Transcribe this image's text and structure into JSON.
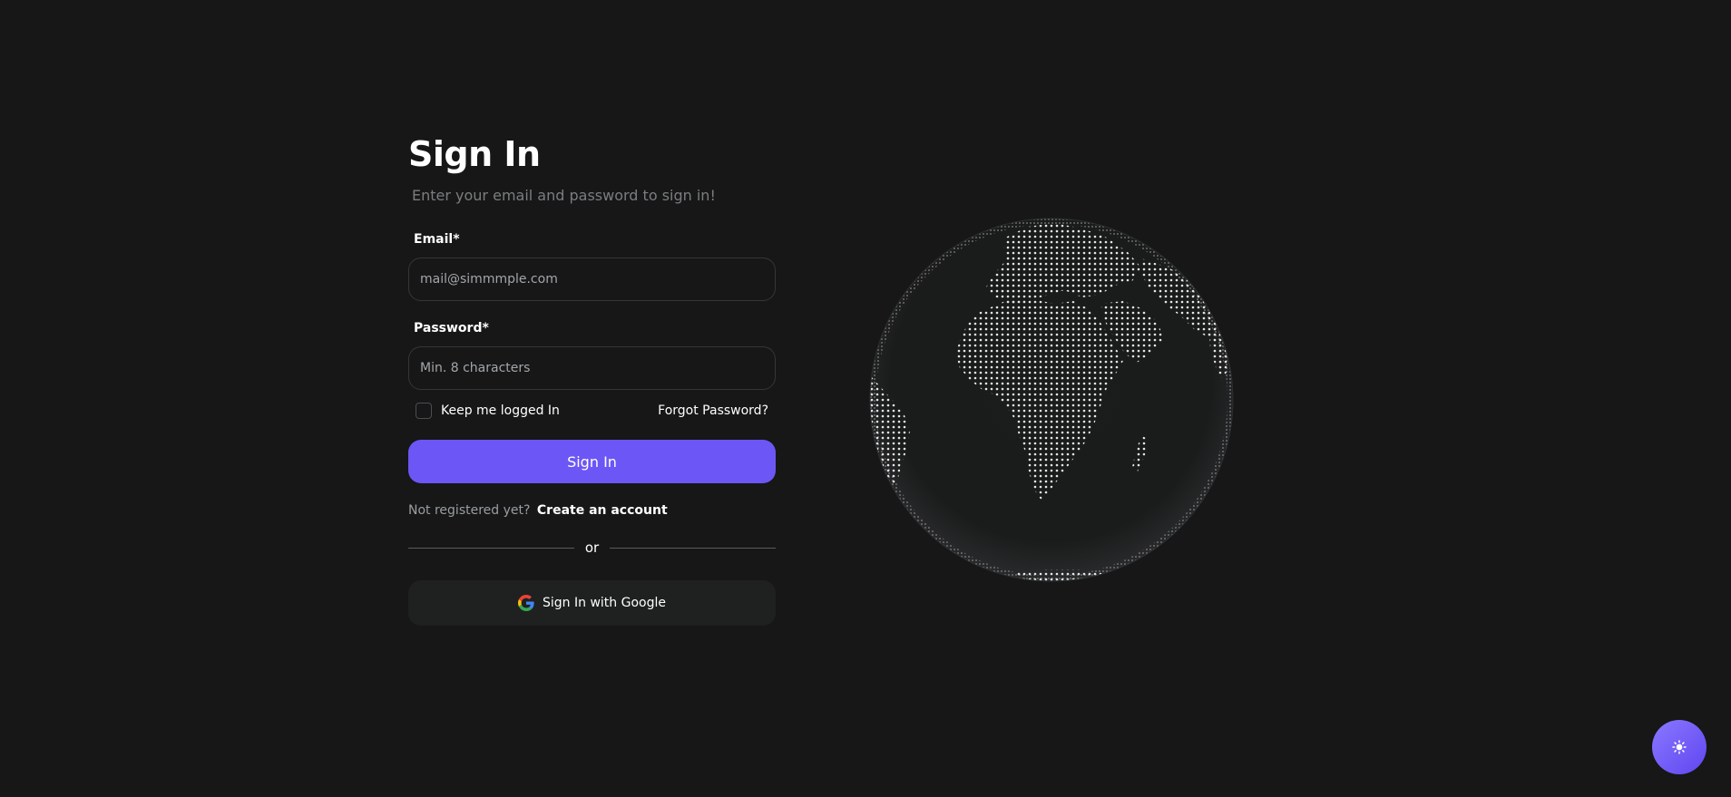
{
  "signin": {
    "title": "Sign In",
    "subtitle": "Enter your email and password to sign in!",
    "email_label": "Email*",
    "email_placeholder": "mail@simmmple.com",
    "password_label": "Password*",
    "password_placeholder": "Min. 8 characters",
    "remember_label": "Keep me logged In",
    "forgot_label": "Forgot Password?",
    "submit_label": "Sign In",
    "register_prompt": "Not registered yet?",
    "register_link": "Create an account",
    "divider_text": "or",
    "google_label": "Sign In with Google"
  },
  "icons": {
    "google": "google-icon",
    "theme_toggle": "sun-icon",
    "globe": "globe-illustration"
  },
  "colors": {
    "background": "#161716",
    "accent": "#6c56f5",
    "muted_text": "#7b7d80",
    "input_border": "#34363a",
    "google_button": "#1f2020"
  }
}
